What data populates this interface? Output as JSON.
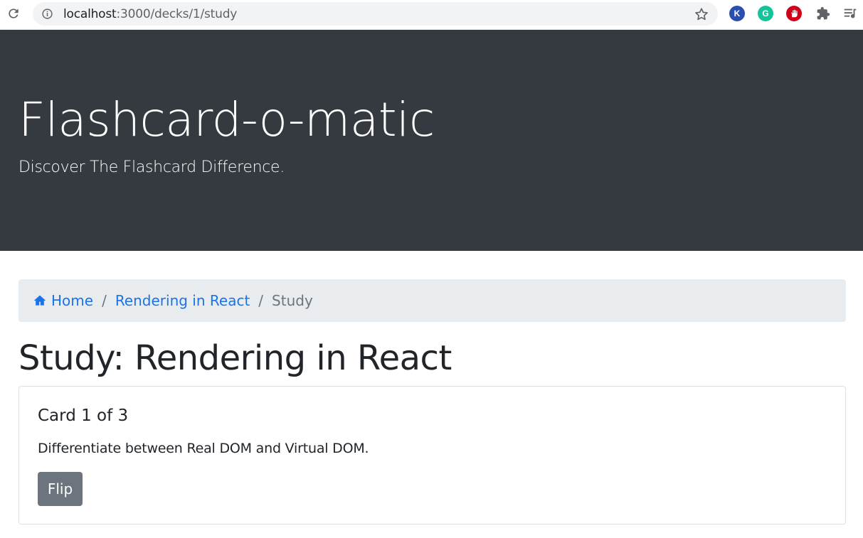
{
  "browser": {
    "url_host": "localhost",
    "url_rest": ":3000/decks/1/study"
  },
  "header": {
    "title": "Flashcard-o-matic",
    "lead": "Discover The Flashcard Difference."
  },
  "breadcrumb": {
    "home_label": "Home",
    "separator": "/",
    "deck_label": "Rendering in React",
    "current_label": "Study"
  },
  "main": {
    "title": "Study: Rendering in React",
    "card": {
      "title": "Card 1 of 3",
      "front_text": "Differentiate between Real DOM and Virtual DOM.",
      "flip_label": "Flip"
    }
  },
  "extensions": {
    "k_label": "K",
    "g_label": "G"
  },
  "colors": {
    "jumbotron": "#343a40",
    "link": "#1a73e8",
    "flip_button": "#6c757d",
    "breadcrumb_bg": "#e9ecef"
  }
}
